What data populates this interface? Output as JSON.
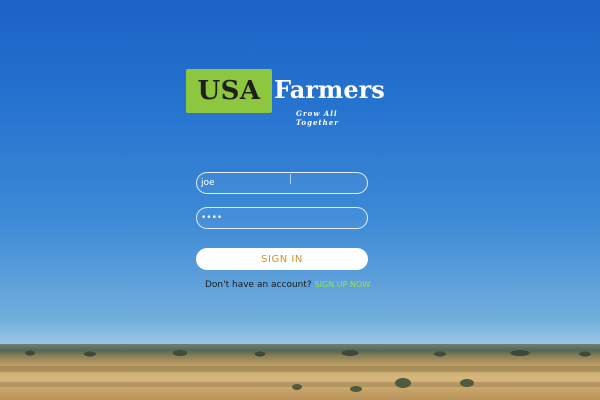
{
  "logo": {
    "box_text": "USA",
    "word": "Farmers",
    "tagline": "Grow All Together"
  },
  "form": {
    "username_value": "joe",
    "password_value": "••••",
    "signin_label": "SIGN IN"
  },
  "signup": {
    "prompt": "Don't have an account?",
    "link_label": "SIGN UP NOW"
  },
  "colors": {
    "logo_box": "#8dc63f",
    "signin_text": "#c8952e",
    "signup_link": "#9be05a"
  }
}
